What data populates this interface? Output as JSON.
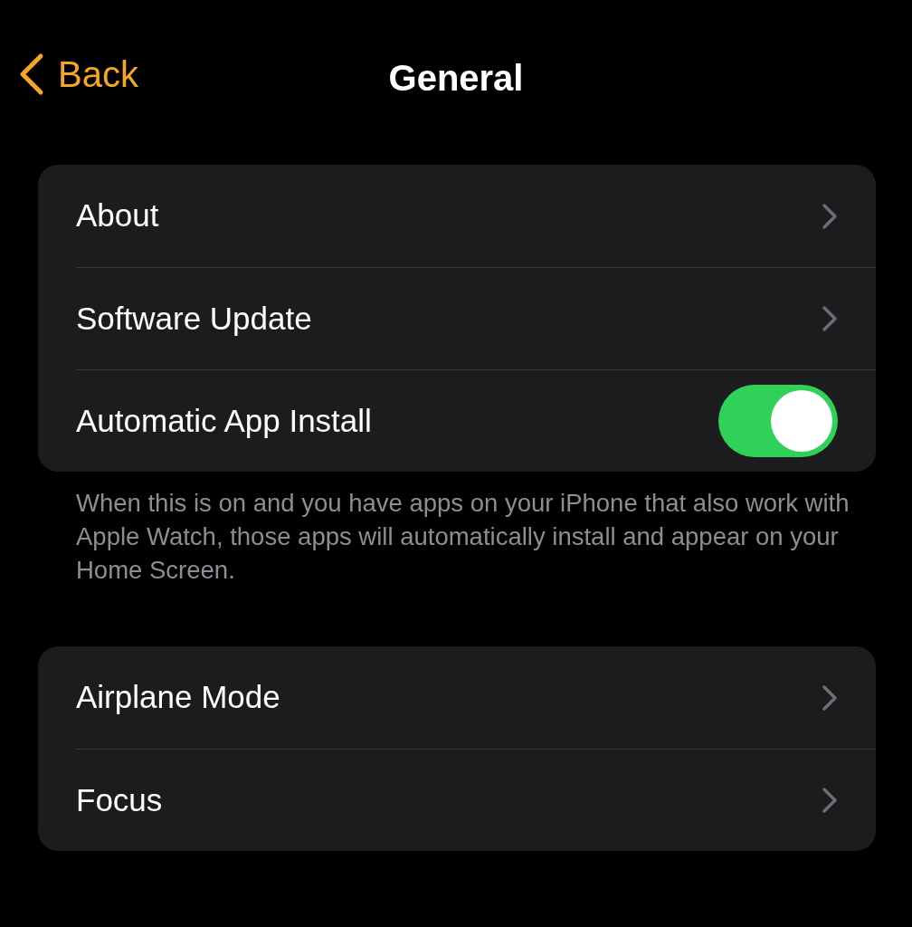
{
  "nav": {
    "back": "Back",
    "title": "General"
  },
  "groups": [
    {
      "rows": [
        {
          "label": "About",
          "kind": "link"
        },
        {
          "label": "Software Update",
          "kind": "link"
        },
        {
          "label": "Automatic App Install",
          "kind": "toggle",
          "on": true
        }
      ],
      "footer": "When this is on and you have apps on your iPhone that also work with Apple Watch, those apps will automatically install and appear on your Home Screen."
    },
    {
      "rows": [
        {
          "label": "Airplane Mode",
          "kind": "link"
        },
        {
          "label": "Focus",
          "kind": "link"
        }
      ]
    }
  ]
}
